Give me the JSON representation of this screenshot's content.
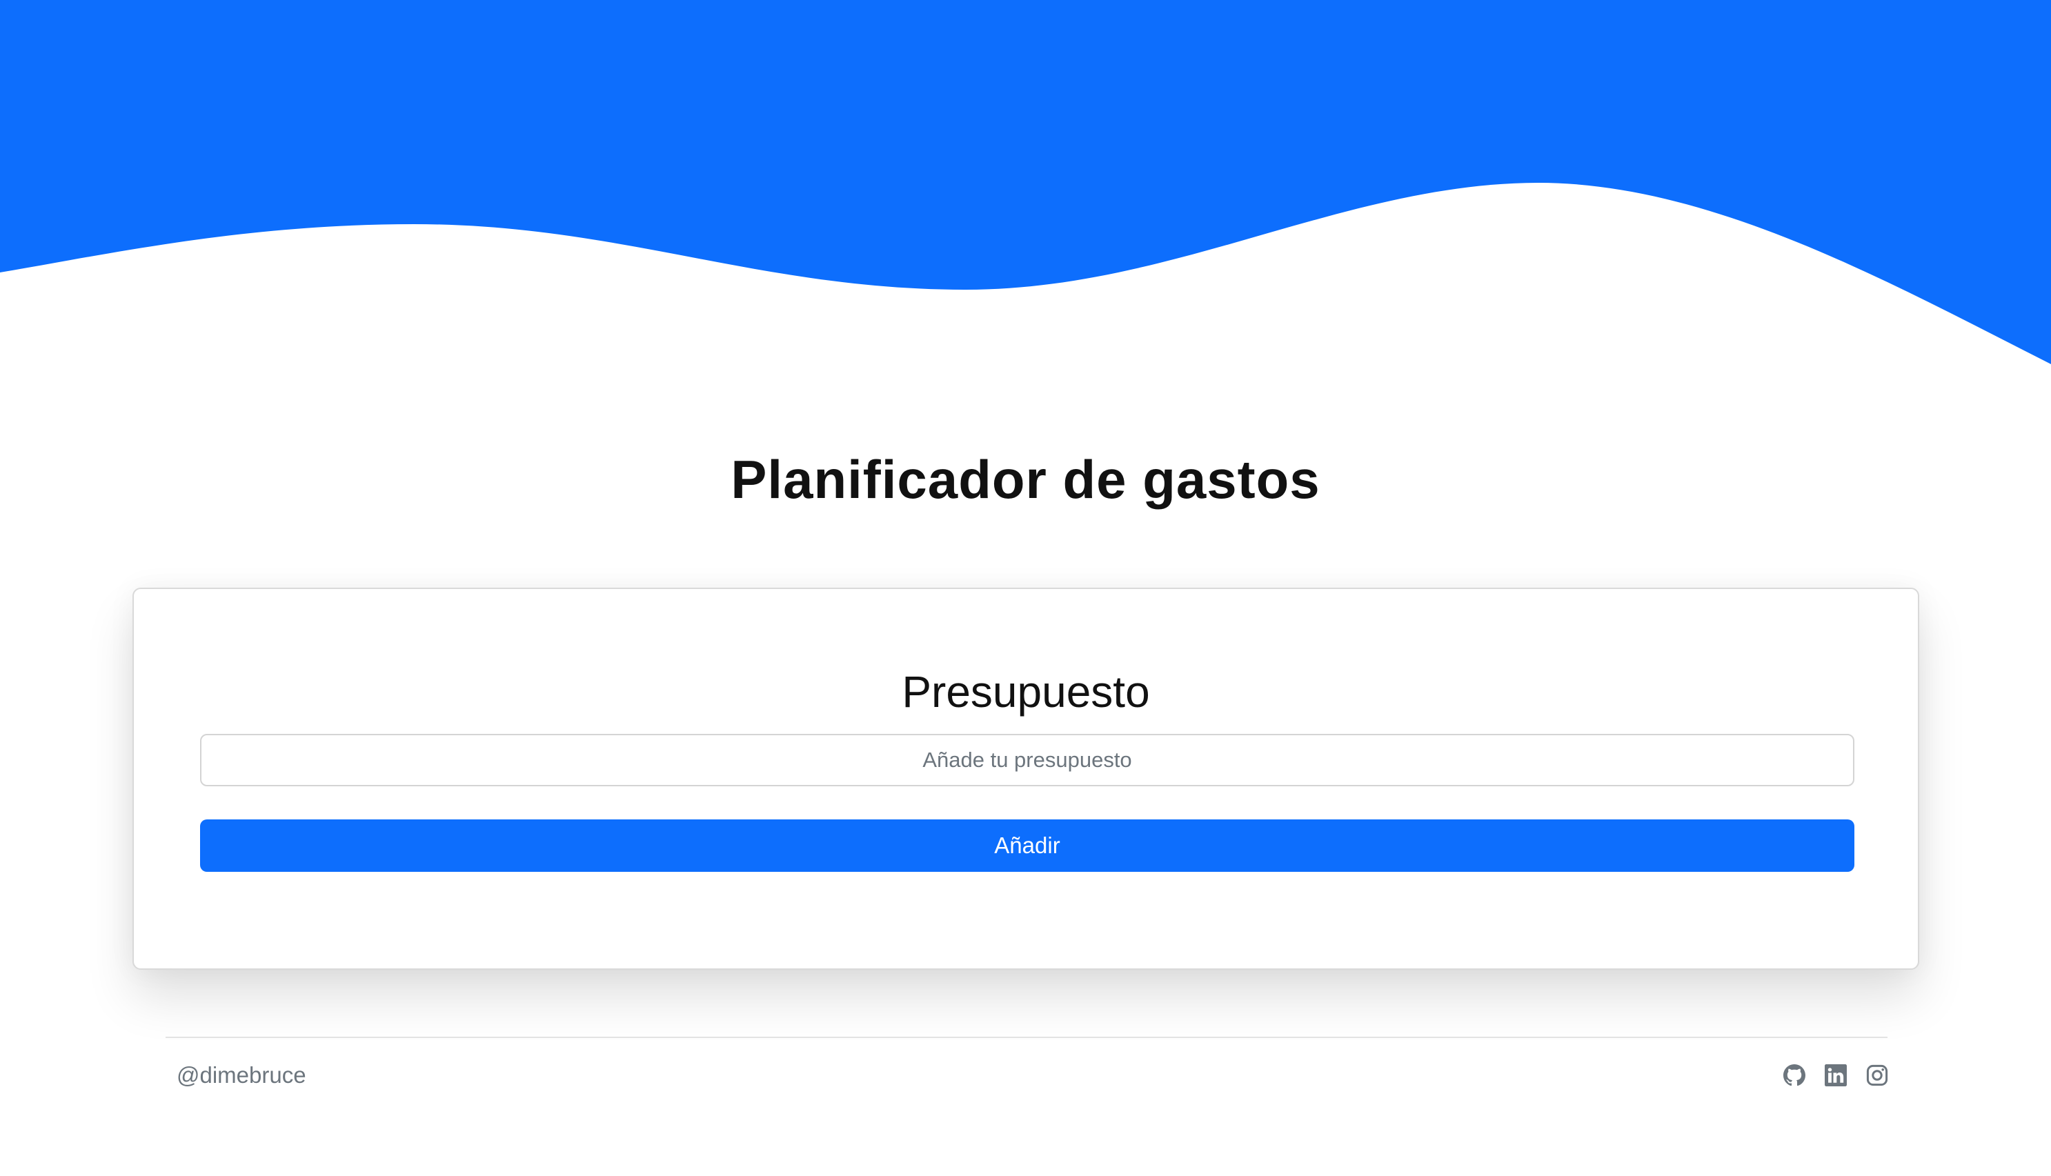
{
  "header": {
    "title": "Planificador de gastos",
    "wave_color": "#0d6efd"
  },
  "budget_card": {
    "title": "Presupuesto",
    "input_placeholder": "Añade tu presupuesto",
    "input_value": "",
    "button_label": "Añadir",
    "button_color": "#0d6efd"
  },
  "footer": {
    "handle": "@dimebruce",
    "icon_color": "#6c757d",
    "social_icons": [
      "github-icon",
      "linkedin-icon",
      "instagram-icon"
    ]
  }
}
